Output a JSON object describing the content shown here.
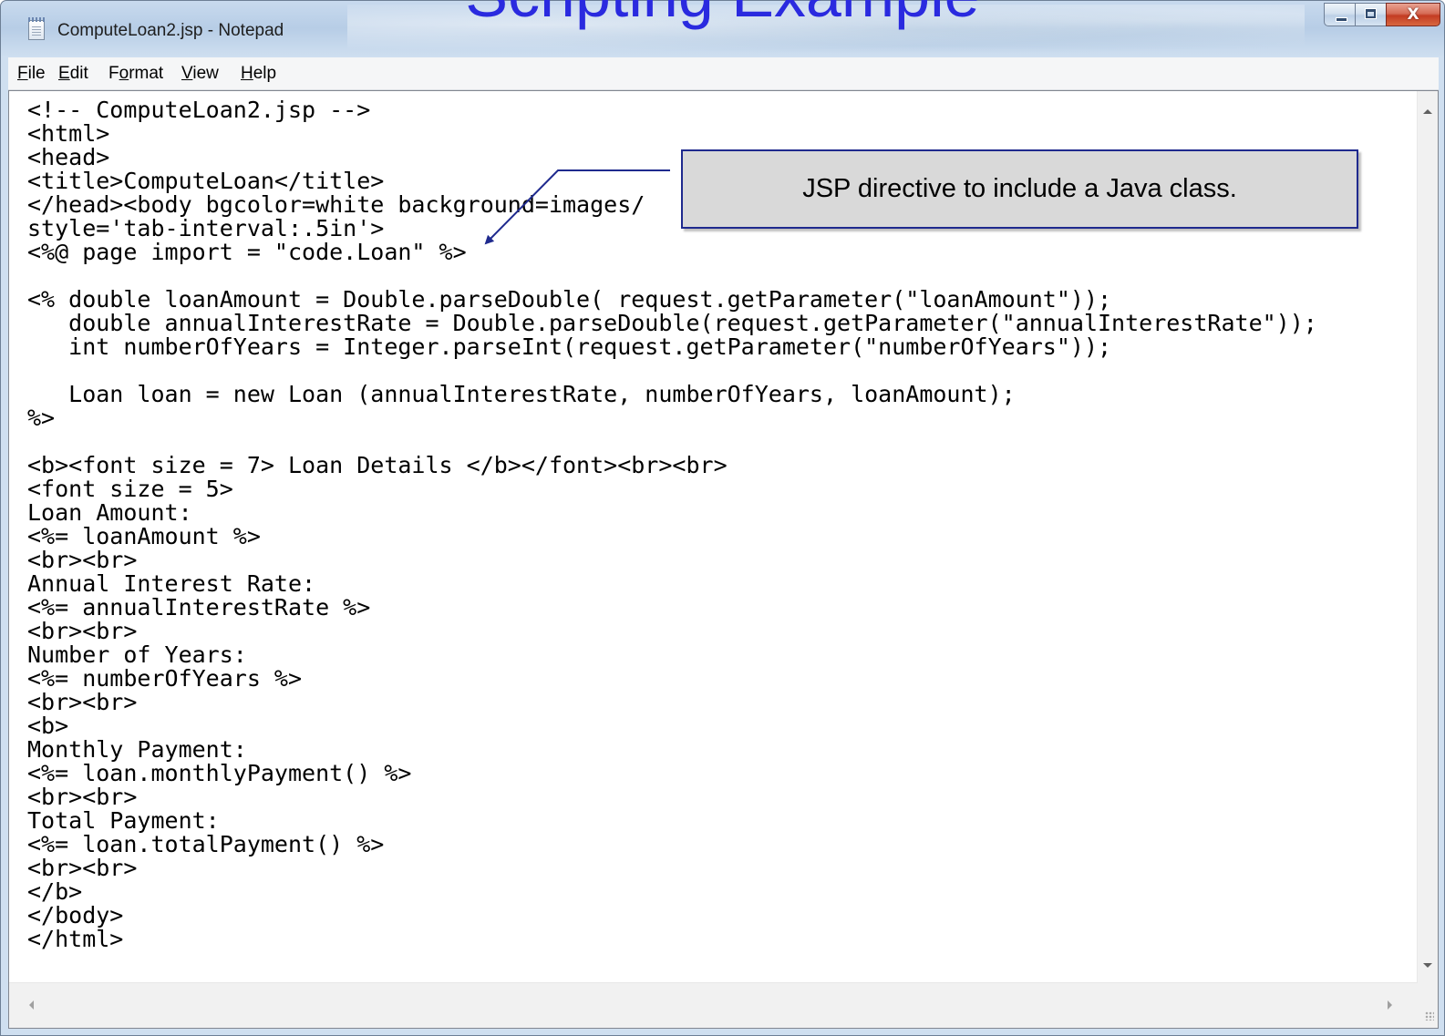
{
  "slide": {
    "title": "Scripting Example"
  },
  "window": {
    "title": "ComputeLoan2.jsp - Notepad",
    "icon": "notepad-icon",
    "caption_buttons": [
      "minimize-icon",
      "maximize-icon",
      "close-icon"
    ],
    "close_glyph": "X"
  },
  "menu": {
    "items": [
      {
        "accel": "F",
        "rest": "ile"
      },
      {
        "accel": "E",
        "rest": "dit"
      },
      {
        "pre": "F",
        "accel": "o",
        "rest": "rmat"
      },
      {
        "accel": "V",
        "rest": "iew"
      },
      {
        "accel": "H",
        "rest": "elp"
      }
    ]
  },
  "editor": {
    "lines": [
      "<!-- ComputeLoan2.jsp -->",
      "<html>",
      "<head>",
      "<title>ComputeLoan</title>",
      "</head><body bgcolor=white background=images/",
      "style='tab-interval:.5in'>",
      "<%@ page import = \"code.Loan\" %>",
      "",
      "<% double loanAmount = Double.parseDouble( request.getParameter(\"loanAmount\"));",
      "   double annualInterestRate = Double.parseDouble(request.getParameter(\"annualInterestRate\"));",
      "   int numberOfYears = Integer.parseInt(request.getParameter(\"numberOfYears\"));",
      "",
      "   Loan loan = new Loan (annualInterestRate, numberOfYears, loanAmount);",
      "%>",
      "",
      "<b><font size = 7> Loan Details </b></font><br><br>",
      "<font size = 5>",
      "Loan Amount:",
      "<%= loanAmount %>",
      "<br><br>",
      "Annual Interest Rate:",
      "<%= annualInterestRate %>",
      "<br><br>",
      "Number of Years:",
      "<%= numberOfYears %>",
      "<br><br>",
      "<b>",
      "Monthly Payment:",
      "<%= loan.monthlyPayment() %>",
      "<br><br>",
      "Total Payment:",
      "<%= loan.totalPayment() %>",
      "<br><br>",
      "</b>",
      "</body>",
      "</html>"
    ]
  },
  "callout": {
    "text": "JSP directive to include a Java class."
  },
  "colors": {
    "title_text": "#2a2adf",
    "callout_border": "#1f2a8e",
    "callout_fill": "#d9d9d9"
  }
}
